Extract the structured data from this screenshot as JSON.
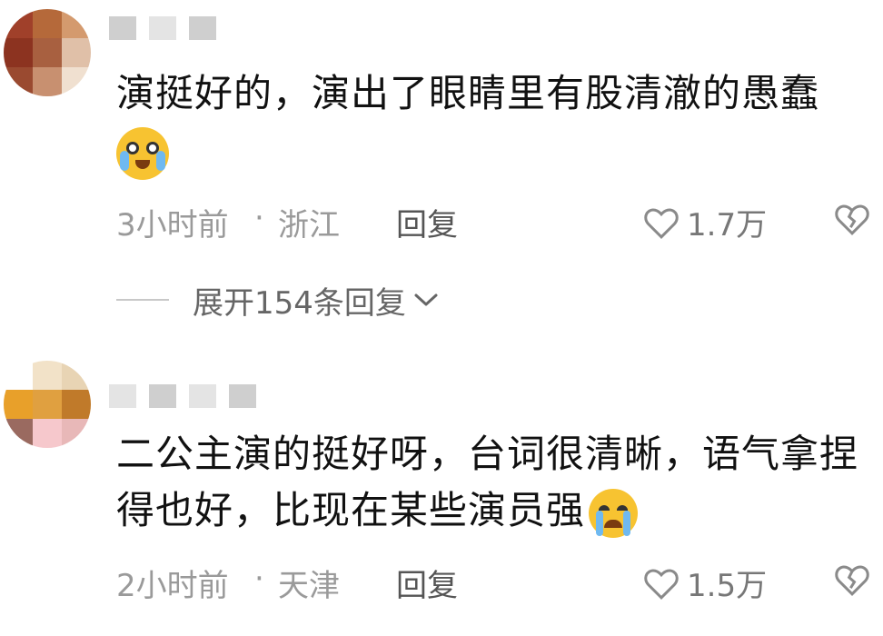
{
  "comments": [
    {
      "text": "演挺好的，演出了眼睛里有股清澈的愚蠢",
      "emoji": "crying-laughing-emoji",
      "time": "3小时前",
      "separator": "·",
      "location": "浙江",
      "reply_label": "回复",
      "likes": "1.7万",
      "expand_label": "展开154条回复",
      "avatar_colors": [
        "#a0402a",
        "#b5693a",
        "#d49a6e",
        "#8c3320",
        "#a86040",
        "#e0c0a8",
        "#9a4a30",
        "#c89070",
        "#f0e0d0"
      ]
    },
    {
      "text": "二公主演的挺好呀，台词很清晰，语气拿捏得也好，比现在某些演员强",
      "emoji": "crying-emoji",
      "time": "2小时前",
      "separator": "·",
      "location": "天津",
      "reply_label": "回复",
      "likes": "1.5万",
      "avatar_colors": [
        "#ffffff",
        "#f2e2c8",
        "#e8d4b4",
        "#e8a02a",
        "#e0a040",
        "#c07a2a",
        "#9a6a60",
        "#f6c8cc",
        "#e8b8b8"
      ]
    }
  ],
  "colors": {
    "meta_gray": "#9a9a9a",
    "emoji_yellow": "#f7c331",
    "tear_blue": "#6fb9f0"
  }
}
